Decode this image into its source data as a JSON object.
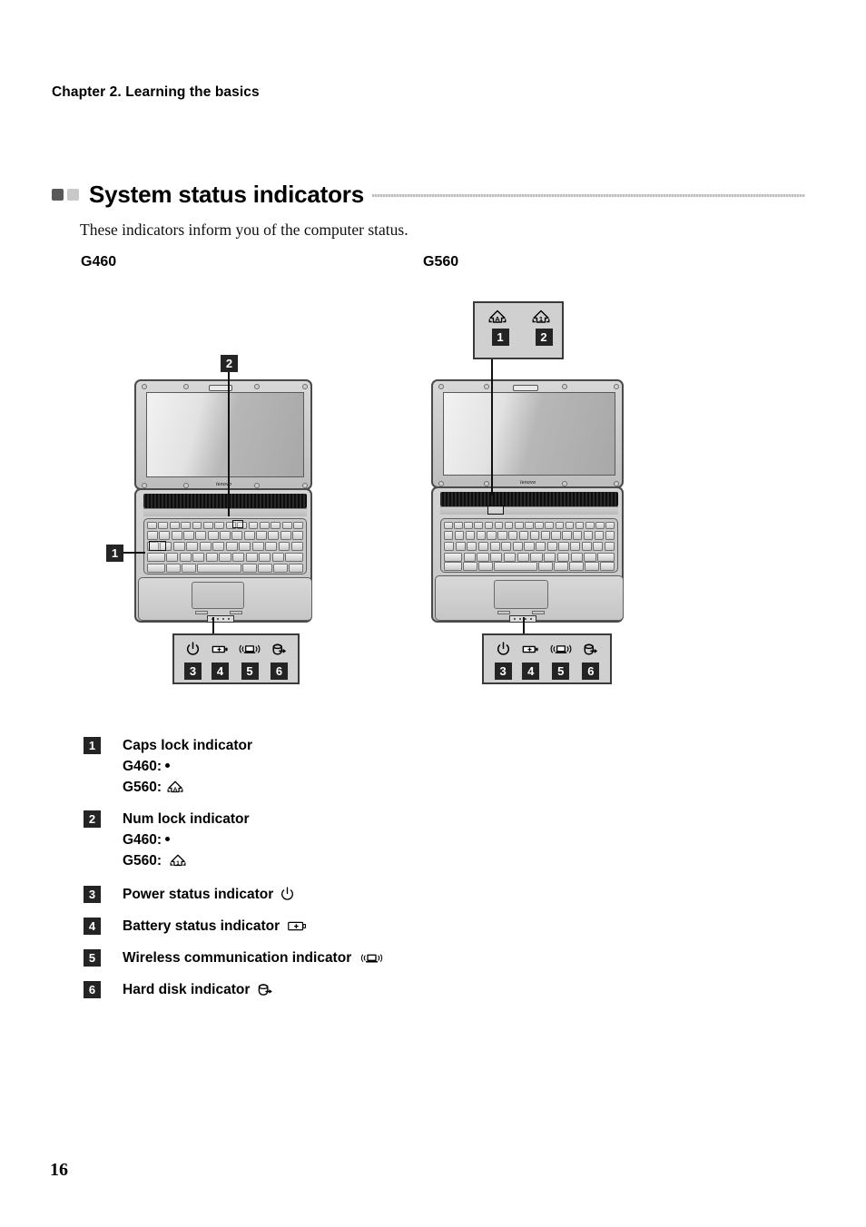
{
  "page": {
    "chapter_head": "Chapter 2. Learning the basics",
    "section_title": "System status indicators",
    "intro": "These indicators inform you of the computer status.",
    "page_number": "16"
  },
  "models": {
    "left": "G460",
    "right": "G560"
  },
  "callouts": {
    "one": "1",
    "two": "2",
    "three": "3",
    "four": "4",
    "five": "5",
    "six": "6"
  },
  "g560_top_panel": {
    "icons": [
      {
        "name": "caps-lock-icon",
        "chip": "1"
      },
      {
        "name": "num-lock-icon",
        "chip": "2"
      }
    ]
  },
  "indicator_panel": {
    "icons": [
      {
        "name": "power-icon",
        "chip": "3"
      },
      {
        "name": "battery-icon",
        "chip": "4"
      },
      {
        "name": "wireless-icon",
        "chip": "5"
      },
      {
        "name": "hard-disk-icon",
        "chip": "6"
      }
    ]
  },
  "legend": [
    {
      "chip": "1",
      "title": "Caps lock indicator",
      "sub": [
        {
          "label": "G460:",
          "glyph": "dot"
        },
        {
          "label": "G560:",
          "glyph": "caps-lock-icon"
        }
      ]
    },
    {
      "chip": "2",
      "title": "Num lock indicator",
      "sub": [
        {
          "label": "G460:",
          "glyph": "dot"
        },
        {
          "label": "G560:",
          "glyph": "num-lock-icon"
        }
      ]
    },
    {
      "chip": "3",
      "title": "Power status indicator",
      "glyph": "power-icon",
      "sub": []
    },
    {
      "chip": "4",
      "title": "Battery status indicator",
      "glyph": "battery-icon",
      "sub": []
    },
    {
      "chip": "5",
      "title": "Wireless communication indicator",
      "glyph": "wireless-icon",
      "sub": []
    },
    {
      "chip": "6",
      "title": "Hard disk indicator",
      "glyph": "hard-disk-icon",
      "sub": []
    }
  ],
  "brand": {
    "logo_text": "lenovo"
  },
  "colors": {
    "bullet_dark": "#595959",
    "bullet_light": "#c9c9c9",
    "chip_bg": "#242424",
    "panel_bg": "#d0d0d0",
    "rule": "#bdbdbd"
  }
}
